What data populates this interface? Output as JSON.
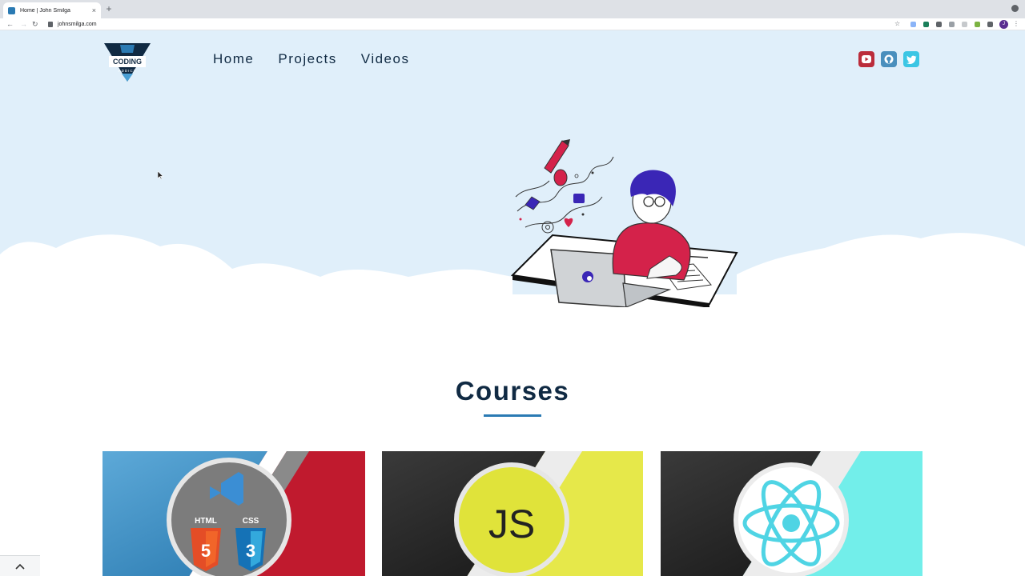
{
  "browser": {
    "tab_title": "Home | John Smilga",
    "tab_close": "×",
    "new_tab": "+",
    "url": "johnsmilga.com",
    "profile_initial": "J"
  },
  "site": {
    "logo_text": "CODING",
    "logo_subtext": "ADDICT",
    "nav": [
      {
        "label": "Home"
      },
      {
        "label": "Projects"
      },
      {
        "label": "Videos"
      }
    ],
    "social": [
      {
        "icon": "youtube-icon",
        "color": "#bb2d3b"
      },
      {
        "icon": "github-icon",
        "color": "#4a8fbd"
      },
      {
        "icon": "twitter-icon",
        "color": "#3cc6e4"
      }
    ]
  },
  "courses": {
    "title": "Courses",
    "cards": [
      {
        "icon": "html-css-icon",
        "badge_left": "HTML",
        "badge_right": "CSS",
        "number_left": "5",
        "number_right": "3",
        "accent_left": "#2a7ab3",
        "accent_right": "#c01a2e"
      },
      {
        "icon": "javascript-icon",
        "badge": "JS",
        "accent_left": "#151515",
        "accent_right": "#e6e84a"
      },
      {
        "icon": "react-icon",
        "accent_left": "#151515",
        "accent_right": "#72eeea"
      }
    ]
  },
  "colors": {
    "hero_bg": "#e0effa",
    "heading": "#102a43",
    "primary": "#2a7ab3"
  }
}
